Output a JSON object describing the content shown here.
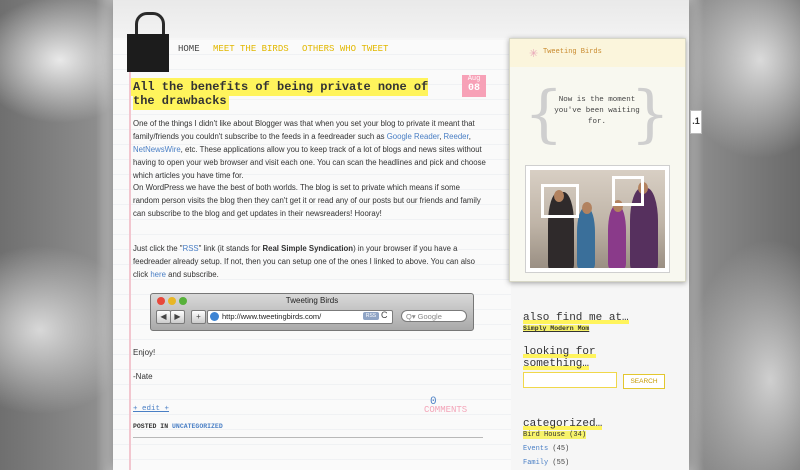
{
  "nav": {
    "home": "HOME",
    "meet": "MEET THE BIRDS",
    "others": "OTHERS WHO TWEET"
  },
  "post": {
    "title": "All the benefits of being private none of the drawbacks",
    "date_month": "Aug",
    "date_day": "08",
    "p1_a": "One of the things I didn't like about Blogger was that when you set your blog to private it meant that family/friends you couldn't subscribe to the feeds in a feedreader such as ",
    "link_google_reader": "Google Reader",
    "comma1": ", ",
    "link_reeder": "Reeder",
    "comma2": ", ",
    "link_netnewswire": "NetNewsWire",
    "p1_b": ", etc. These applications allow you to keep track of a lot of blogs and news sites without having to open your web browser and visit each one. You can scan the headlines and pick and choose which articles you have time for.",
    "p2": "On WordPress we have the best of both worlds. The blog is set to private which means if some random person visits the blog then they can't get it or read any of our posts but our friends and family can subscribe to the blog and get updates in their newsreaders! Hooray!",
    "p3_a": "Just click the \"",
    "link_rss": "RSS",
    "p3_b": "\" link (it stands for ",
    "p3_bold": "Real Simple Syndication",
    "p3_c": ") in your browser if you have a feedreader already setup. If not, then you can setup one of the ones I linked to above. You can also click ",
    "link_here": "here",
    "p3_d": " and subscribe.",
    "enjoy": "Enjoy!",
    "signature": "-Nate",
    "edit": "+ edit +",
    "comments_count": "0",
    "comments_label": "COMMENTS",
    "posted_in": "POSTED IN",
    "category": "UNCATEGORIZED"
  },
  "browser": {
    "title": "Tweeting Birds",
    "back": "◀",
    "forward": "▶",
    "add": "+",
    "url": "http://www.tweetingbirds.com/",
    "rss": "RSS",
    "reload": "C",
    "search_placeholder": "Q▾ Google"
  },
  "sidebar": {
    "card_title": "Tweeting Birds",
    "quote": "Now is the moment you've been waiting for.",
    "tab_number": ".1",
    "also_title": "also find me at…",
    "also_link": "Simply Modern Mom",
    "looking_title": "looking for something…",
    "search_button": "SEARCH",
    "categorized_title": "categorized…",
    "categories": [
      {
        "name": "Bird House",
        "count": "(34)"
      },
      {
        "name": "Events",
        "count": "(45)"
      },
      {
        "name": "Family",
        "count": "(55)"
      }
    ]
  },
  "colors": {
    "accent_yellow": "#fff45c",
    "link_blue": "#4a7fc5",
    "pink": "#f7a1b7"
  }
}
